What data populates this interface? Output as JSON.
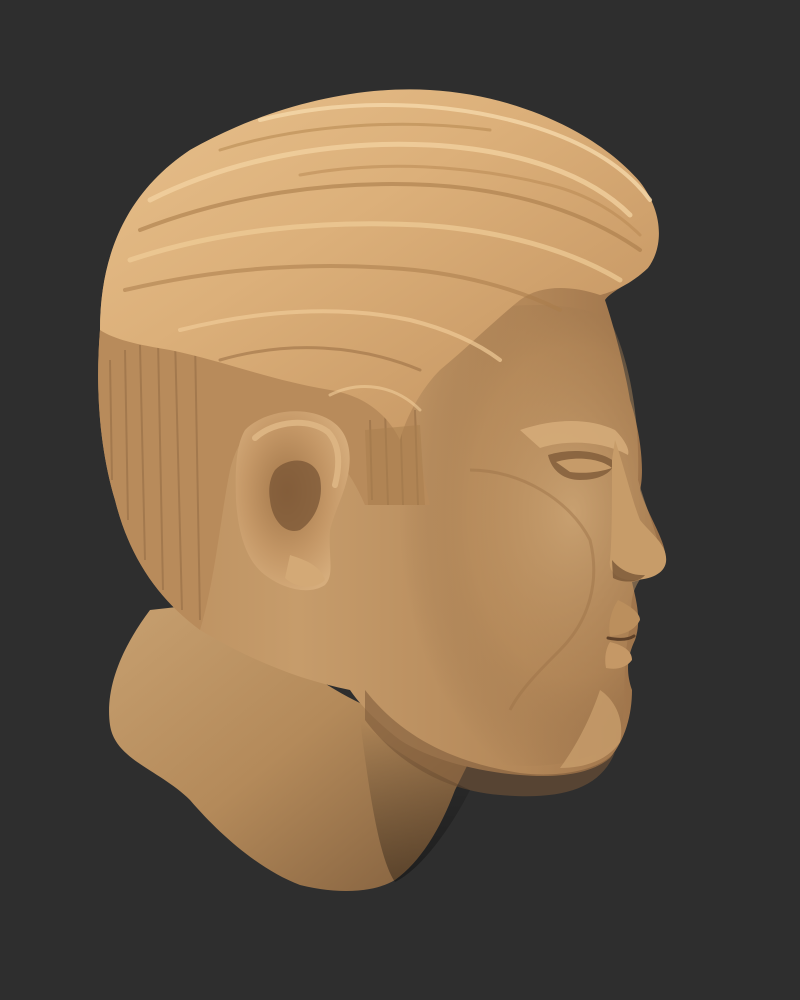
{
  "scene": {
    "background_color": "#2e2e2e",
    "subject": "clay-head-sculpt",
    "view": "right-profile-three-quarter",
    "material_colors": {
      "clay_light": "#e9c390",
      "clay_mid": "#c99e6c",
      "clay_shadow": "#8a6542",
      "clay_deep": "#5e4129",
      "hair_highlight": "#f3d3a2"
    }
  }
}
